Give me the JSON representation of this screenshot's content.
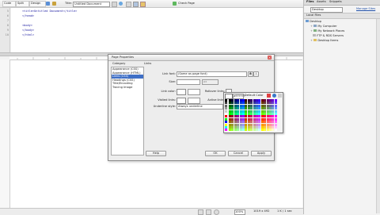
{
  "toolbar": {
    "code_tab": "Code",
    "split_tab": "Split",
    "design_tab": "Design",
    "title_label": "Title:",
    "title_value": "Untitled Document",
    "check_page": "Check Page"
  },
  "code": {
    "line_numbers": [
      "5",
      "6",
      "7",
      "8",
      "9",
      "10"
    ],
    "lines": [
      "<title>Untitled Document</title>",
      "</head>",
      "",
      "<body>",
      "</body>",
      "</html>"
    ]
  },
  "files_panel": {
    "tabs": [
      "Files",
      "Assets",
      "Snippets"
    ],
    "site_select": "Desktop",
    "manage_sites": "Manage Sites",
    "header": "Local Files",
    "tree": [
      "Desktop",
      "My Computer",
      "My Network Places",
      "FTP & RDS Servers",
      "Desktop Items"
    ]
  },
  "dialog": {
    "title": "Page Properties",
    "category_label": "Category",
    "section_label": "Links",
    "categories": [
      "Appearance (CSS)",
      "Appearance (HTML)",
      "Links (CSS)",
      "Headings (CSS)",
      "Title/Encoding",
      "Tracing Image"
    ],
    "selected_category": "Links (CSS)",
    "link_font_label": "Link font:",
    "link_font_value": "(Same as page font)",
    "size_label": "Size:",
    "size_unit": "px",
    "link_color_label": "Link color:",
    "rollover_label": "Rollover links:",
    "visited_label": "Visited links:",
    "active_label": "Active links:",
    "underline_label": "Underline style:",
    "underline_value": "Always underline",
    "help": "Help",
    "ok": "OK",
    "cancel": "Cancel",
    "apply": "Apply"
  },
  "color_picker": {
    "value": "#FFFFFF",
    "default_label": "Default Color"
  },
  "status": {
    "zoom": "100%",
    "dimensions": "1019 x 492",
    "size_time": "1 K / 1 sec"
  },
  "colors": {
    "selection": "#3f6fc6",
    "code_text": "#1a1aa0"
  }
}
